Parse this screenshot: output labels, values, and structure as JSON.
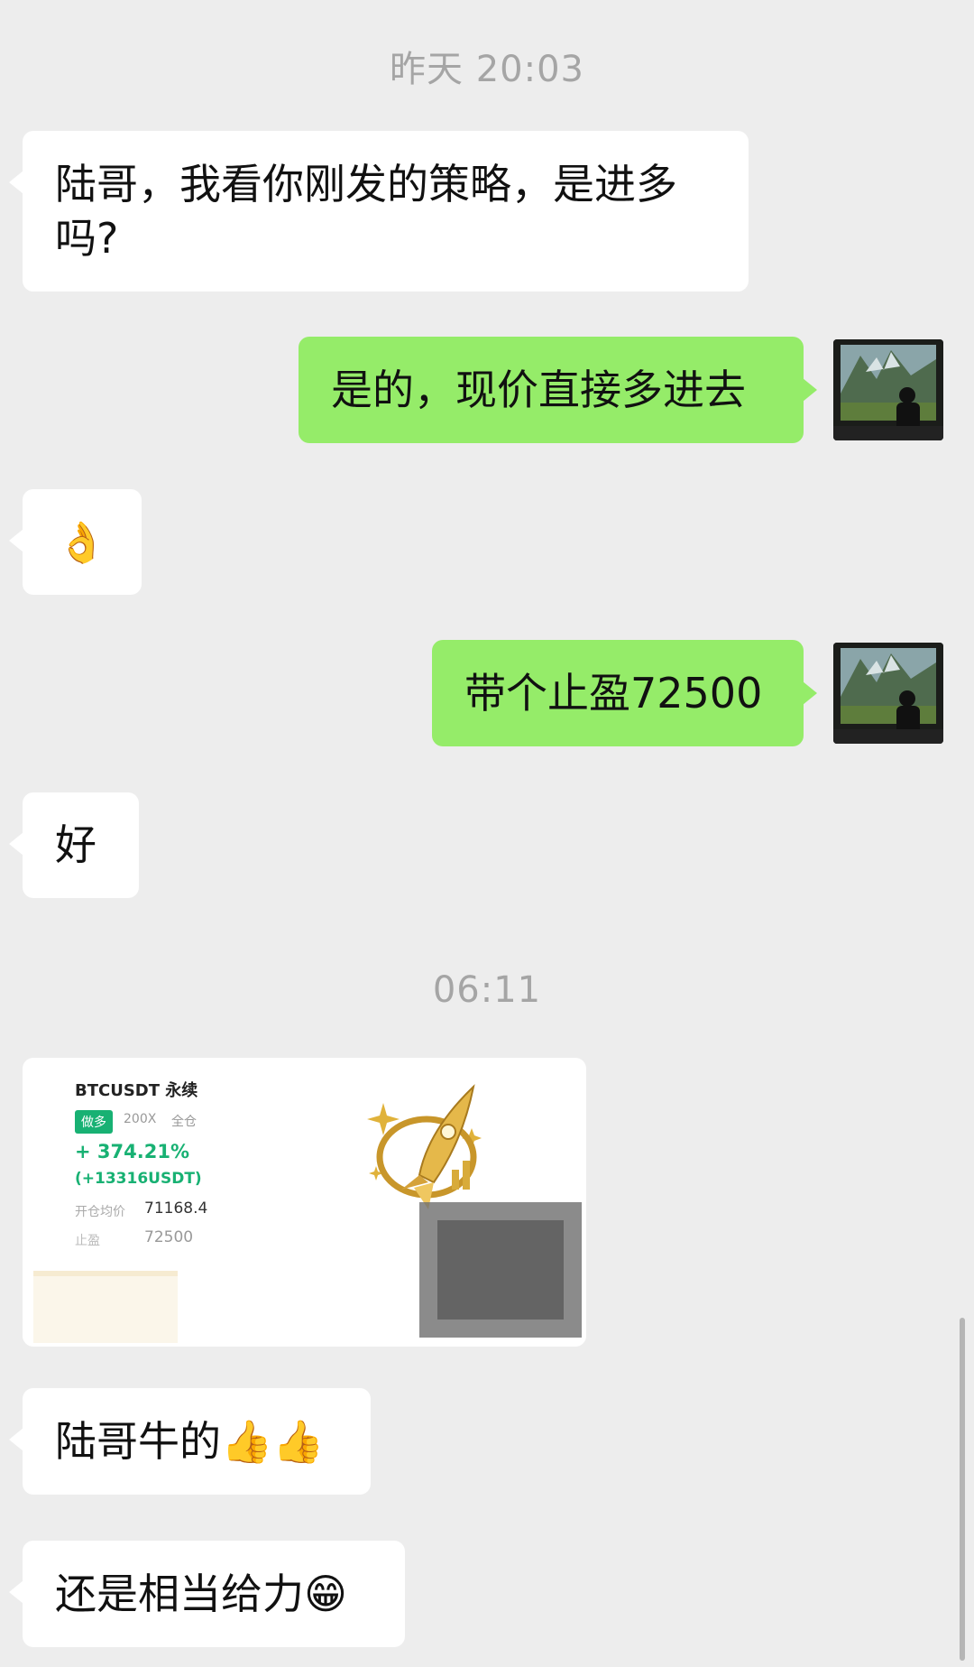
{
  "timestamps": [
    "昨天 20:03",
    "06:11"
  ],
  "messages": {
    "m1": "陆哥，我看你刚发的策略，是进多吗?",
    "m2": "是的，现价直接多进去",
    "m3": "👌",
    "m4": "带个止盈72500",
    "m5": "好",
    "m6": "陆哥牛的👍👍",
    "m7": "还是相当给力😁"
  },
  "trade_card": {
    "symbol": "BTCUSDT 永续",
    "side": "做多",
    "leverage": "200X",
    "margin_mode": "全仓",
    "pnl_percent": "+ 374.21%",
    "pnl_amount": "(+13316USDT)",
    "entry_label": "开仓均价",
    "entry_price": "71168.4",
    "tp_label": "止盈",
    "tp_price": "72500"
  },
  "colors": {
    "background": "#ededed",
    "incoming_bubble": "#ffffff",
    "outgoing_bubble": "#95ec69",
    "profit_green": "#18b173",
    "timestamp": "#a5a5a5"
  }
}
